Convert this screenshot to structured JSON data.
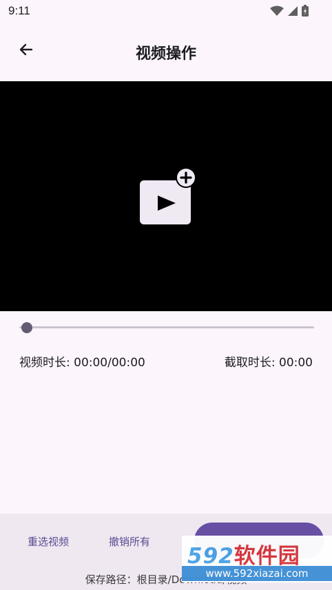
{
  "status": {
    "time": "9:11"
  },
  "app_bar": {
    "title": "视频操作"
  },
  "video": {
    "placeholder_icon": "video-add-icon",
    "progress": 0
  },
  "info": {
    "duration_label": "视频时长: 00:00/00:00",
    "clip_label": "截取时长: 00:00"
  },
  "actions": {
    "reselect_label": "重选视频",
    "undo_label": "撤销所有",
    "export_label": ""
  },
  "save_path": "保存路径：根目录/Download/视频",
  "watermark": {
    "brand_number": "592",
    "brand_cn": "软件园",
    "url": "www.592xiazai.com"
  },
  "colors": {
    "accent": "#6750a4",
    "background": "#fcf6fc",
    "video_bg": "#000000"
  }
}
